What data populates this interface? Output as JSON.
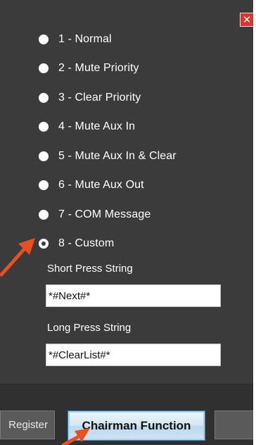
{
  "window": {
    "close_glyph": "✕"
  },
  "options": [
    {
      "label": "1 - Normal",
      "selected": false
    },
    {
      "label": "2 - Mute Priority",
      "selected": false
    },
    {
      "label": "3 - Clear Priority",
      "selected": false
    },
    {
      "label": "4 - Mute Aux In",
      "selected": false
    },
    {
      "label": "5 - Mute Aux In & Clear",
      "selected": false
    },
    {
      "label": "6 - Mute Aux Out",
      "selected": false
    },
    {
      "label": "7 - COM Message",
      "selected": false
    },
    {
      "label": "8 - Custom",
      "selected": true
    }
  ],
  "short_press": {
    "label": "Short Press String",
    "value": "*#Next#*"
  },
  "long_press": {
    "label": "Long Press String",
    "value": "*#ClearList#*"
  },
  "footer": {
    "register_label": "Register",
    "chairman_label": "Chairman Function"
  },
  "colors": {
    "panel_bg": "#3b3b3b",
    "close_button": "#d8362a",
    "annotation_arrow": "#e8501e",
    "active_button_border": "#3c7fb1"
  },
  "icons": {
    "close": "close-icon",
    "annotation": "arrow-annotation-icon"
  }
}
